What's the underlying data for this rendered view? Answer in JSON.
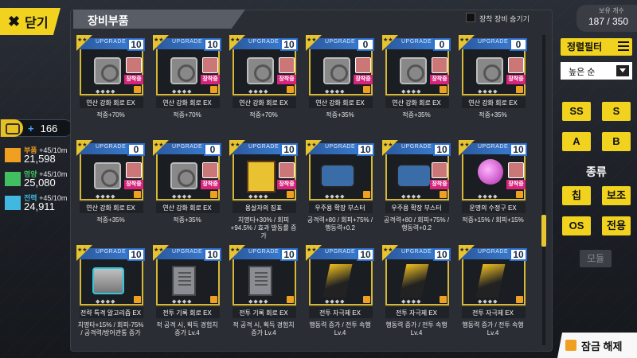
{
  "close": {
    "label": "닫기"
  },
  "level": {
    "value": "166"
  },
  "resources": [
    {
      "name": "부품",
      "rate": "+45/10m",
      "value": "21,598",
      "color": "#f0a020"
    },
    {
      "name": "영양",
      "rate": "+45/10m",
      "value": "25,080",
      "color": "#40c060"
    },
    {
      "name": "전력",
      "rate": "+45/10m",
      "value": "24,911",
      "color": "#40b8e0"
    }
  ],
  "panel": {
    "title": "장비부품",
    "hide_equipped_label": "장착 장비 숨기기"
  },
  "held": {
    "label": "보유 개수",
    "value": "187 / 350"
  },
  "filter": {
    "label": "정렬필터"
  },
  "sort": {
    "value": "높은 순"
  },
  "grades": [
    "SS",
    "S",
    "A",
    "B"
  ],
  "type_label": "종류",
  "types": [
    "칩",
    "보조",
    "OS",
    "전용"
  ],
  "all_label": "모듈",
  "unlock_label": "잠금 해제",
  "card_common": {
    "upgrade_label": "UPGRADE",
    "equipped_label": "장착중"
  },
  "cards": [
    {
      "name": "연산 강화 회로 EX",
      "level": "10",
      "stat": "적중+70%",
      "art": "disc",
      "equipped": true
    },
    {
      "name": "연산 강화 회로 EX",
      "level": "10",
      "stat": "적중+70%",
      "art": "disc",
      "equipped": true
    },
    {
      "name": "연산 강화 회로 EX",
      "level": "10",
      "stat": "적중+70%",
      "art": "disc",
      "equipped": true
    },
    {
      "name": "연산 강화 회로 EX",
      "level": "0",
      "stat": "적중+35%",
      "art": "disc",
      "equipped": true
    },
    {
      "name": "연산 강화 회로 EX",
      "level": "0",
      "stat": "적중+35%",
      "art": "disc",
      "equipped": true
    },
    {
      "name": "연산 강화 회로 EX",
      "level": "0",
      "stat": "적중+35%",
      "art": "disc",
      "equipped": true
    },
    {
      "name": "연산 강화 회로 EX",
      "level": "0",
      "stat": "적중+35%",
      "art": "disc",
      "equipped": true
    },
    {
      "name": "연산 강화 회로 EX",
      "level": "0",
      "stat": "적중+35%",
      "art": "disc",
      "equipped": true
    },
    {
      "name": "용살자의 징표",
      "level": "10",
      "stat": "치명타+30% / 회피+94.5% / 효과 발동률 증가",
      "art": "book",
      "equipped": true
    },
    {
      "name": "우주용 확장 부스터",
      "level": "10",
      "stat": "공격력+80 / 회피+75% / 행동력+0.2",
      "art": "booster",
      "equipped": false
    },
    {
      "name": "우주용 확장 부스터",
      "level": "10",
      "stat": "공격력+80 / 회피+75% / 행동력+0.2",
      "art": "booster",
      "equipped": true
    },
    {
      "name": "운명의 수정구 EX",
      "level": "10",
      "stat": "적중+15% / 회피+15%",
      "art": "orb",
      "equipped": true
    },
    {
      "name": "전략 특격 알고리즘 EX",
      "level": "10",
      "stat": "치명타+15% / 회피-75% / 공격력/방어관통 증가",
      "art": "chip",
      "equipped": false
    },
    {
      "name": "전투 기록 회로 EX",
      "level": "10",
      "stat": "적 공격 시, 획득 경험치 증가 Lv.4",
      "art": "doc",
      "equipped": false
    },
    {
      "name": "전투 기록 회로 EX",
      "level": "10",
      "stat": "적 공격 시, 획득 경험치 증가 Lv.4",
      "art": "doc",
      "equipped": false
    },
    {
      "name": "전투 자극제 EX",
      "level": "10",
      "stat": "행동력 증가 / 전투 속행 Lv.4",
      "art": "blade",
      "equipped": false
    },
    {
      "name": "전투 자극제 EX",
      "level": "10",
      "stat": "행동력 증가 / 전투 속행 Lv.4",
      "art": "blade",
      "equipped": false
    },
    {
      "name": "전투 자극제 EX",
      "level": "10",
      "stat": "행동력 증가 / 전투 속행 Lv.4",
      "art": "blade",
      "equipped": false
    }
  ]
}
